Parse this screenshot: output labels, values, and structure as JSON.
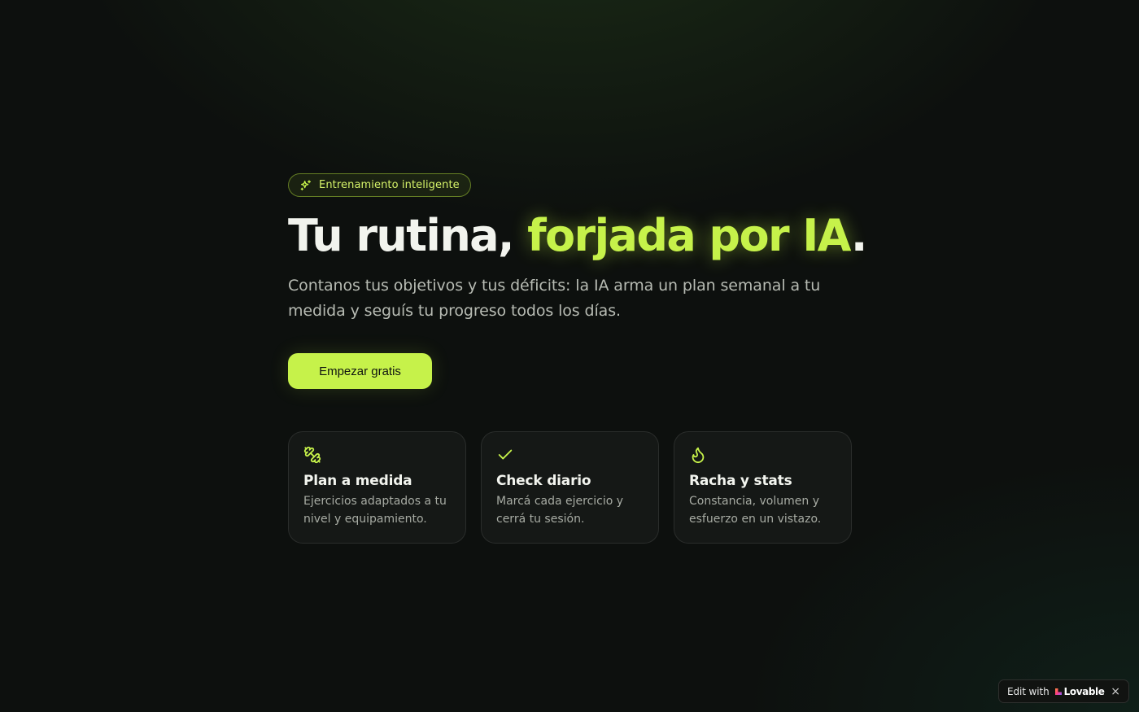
{
  "badge": {
    "label": "Entrenamiento inteligente",
    "icon": "sparkles-icon"
  },
  "headline": {
    "part1": "Tu rutina, ",
    "accent": "forjada por IA",
    "end": "."
  },
  "subtitle": "Contanos tus objetivos y tus déficits: la IA arma un plan semanal a tu medida y seguís tu progreso todos los días.",
  "cta": {
    "label": "Empezar gratis"
  },
  "features": [
    {
      "icon": "dumbbell-icon",
      "title": "Plan a medida",
      "description": "Ejercicios adaptados a tu nivel y equipamiento."
    },
    {
      "icon": "check-icon",
      "title": "Check diario",
      "description": "Marcá cada ejercicio y cerrá tu sesión."
    },
    {
      "icon": "flame-icon",
      "title": "Racha y stats",
      "description": "Constancia, volumen y esfuerzo en un vistazo."
    }
  ],
  "edit_widget": {
    "prefix": "Edit with",
    "brand": "Lovable",
    "close": "×"
  },
  "colors": {
    "accent": "#c6f24a",
    "background": "#0d100e",
    "text": "#f2f4ee",
    "muted": "#b7bbb3"
  }
}
